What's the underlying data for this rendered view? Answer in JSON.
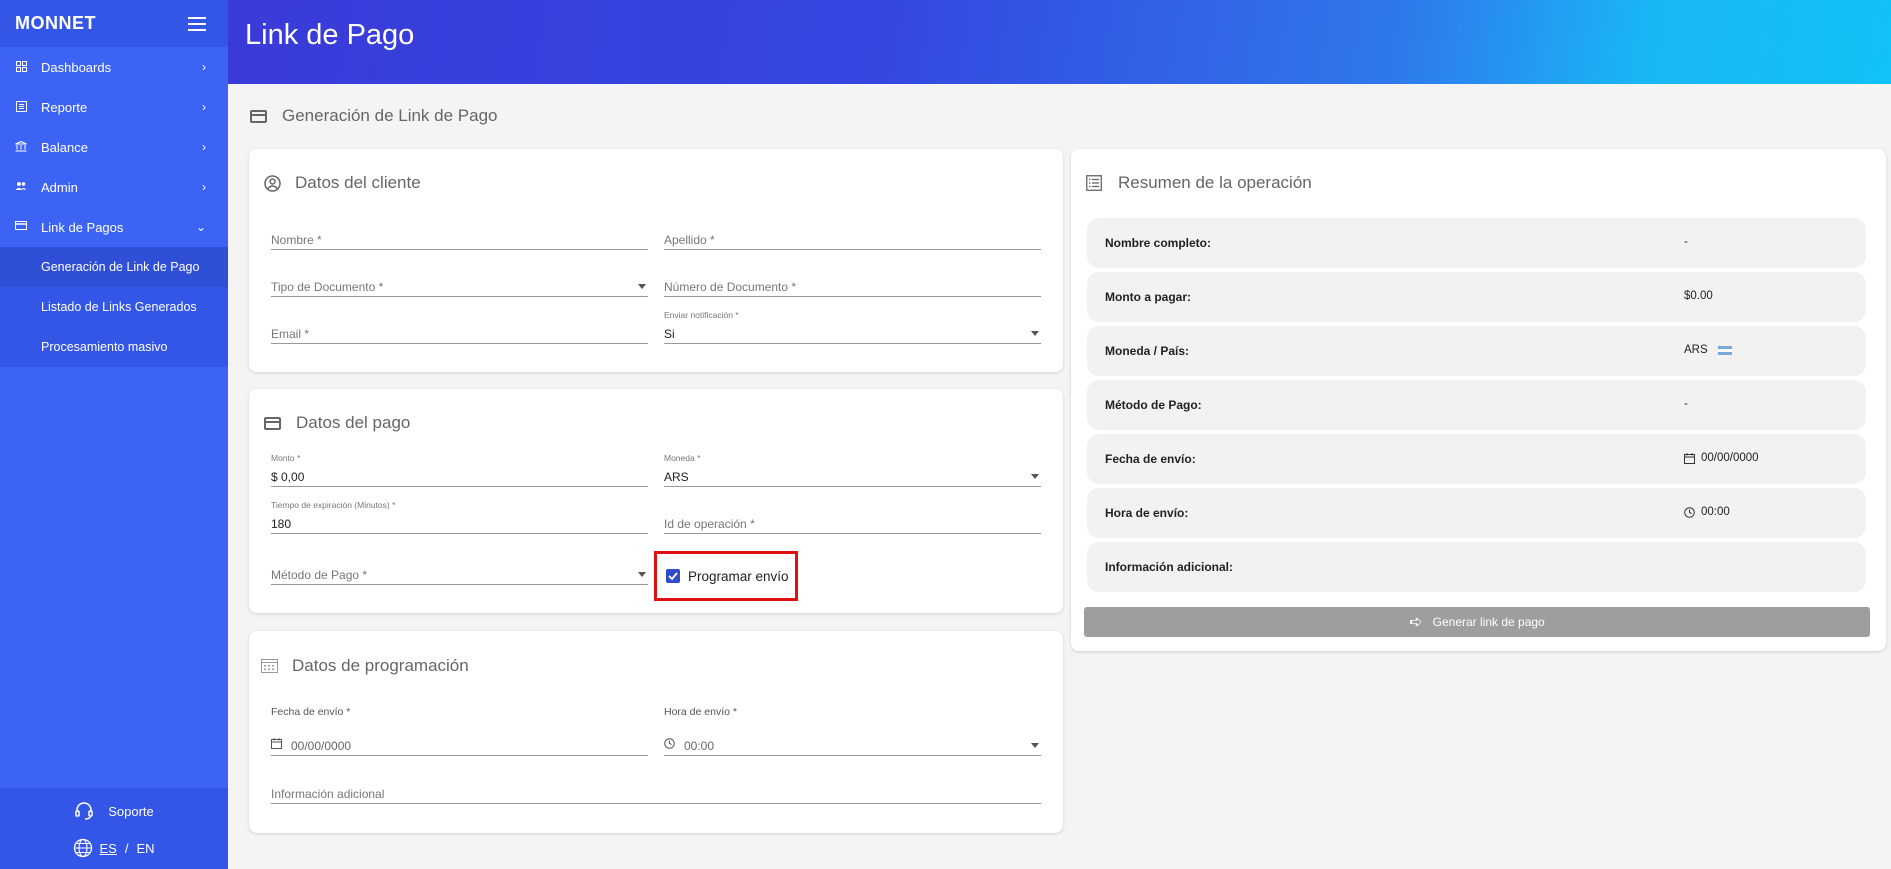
{
  "sidebar": {
    "logo": "MONNET",
    "items": [
      {
        "label": "Dashboards",
        "icon": "dashboard-icon"
      },
      {
        "label": "Reporte",
        "icon": "report-icon"
      },
      {
        "label": "Balance",
        "icon": "bank-icon"
      },
      {
        "label": "Admin",
        "icon": "users-icon"
      },
      {
        "label": "Link de Pagos",
        "icon": "card-icon"
      }
    ],
    "subitems": [
      {
        "label": "Generación de Link de Pago"
      },
      {
        "label": "Listado de Links Generados"
      },
      {
        "label": "Procesamiento masivo"
      }
    ],
    "support": "Soporte",
    "lang_es": "ES",
    "lang_sep": "/",
    "lang_en": "EN"
  },
  "header": {
    "title": "Link de Pago"
  },
  "page": {
    "section_title": "Generación de Link de Pago"
  },
  "cliente": {
    "title": "Datos del cliente",
    "nombre_ph": "Nombre *",
    "apellido_ph": "Apellido *",
    "tipo_doc_ph": "Tipo de Documento *",
    "num_doc_ph": "Número de Documento *",
    "email_ph": "Email *",
    "notif_label": "Enviar notificación *",
    "notif_value": "Si"
  },
  "pago": {
    "title": "Datos del pago",
    "monto_label": "Monto *",
    "monto_value": "$ 0,00",
    "moneda_label": "Moneda *",
    "moneda_value": "ARS",
    "expiracion_label": "Tiempo de expiración (Minutos) *",
    "expiracion_value": "180",
    "id_op_ph": "Id de operación *",
    "metodo_ph": "Método de Pago *",
    "programar_label": "Programar envío",
    "programar_checked": true
  },
  "programacion": {
    "title": "Datos de programación",
    "fecha_label": "Fecha de envío *",
    "fecha_value": "00/00/0000",
    "hora_label": "Hora de envío *",
    "hora_value": "00:00",
    "info_ph": "Información adicional"
  },
  "resumen": {
    "title": "Resumen de la operación",
    "rows": [
      {
        "key": "Nombre completo:",
        "value": "-"
      },
      {
        "key": "Monto a pagar:",
        "value": "$0.00"
      },
      {
        "key": "Moneda / País:",
        "value": "ARS"
      },
      {
        "key": "Método de Pago:",
        "value": "-"
      },
      {
        "key": "Fecha de envío:",
        "value": "00/00/0000"
      },
      {
        "key": "Hora de envío:",
        "value": "00:00"
      },
      {
        "key": "Información adicional:",
        "value": ""
      }
    ],
    "button_label": "Generar link de pago"
  },
  "colors": {
    "sidebar": "#3d63f5",
    "accent": "#2f4bc9",
    "button_disabled": "#9e9e9e",
    "highlight": "#e01010"
  }
}
